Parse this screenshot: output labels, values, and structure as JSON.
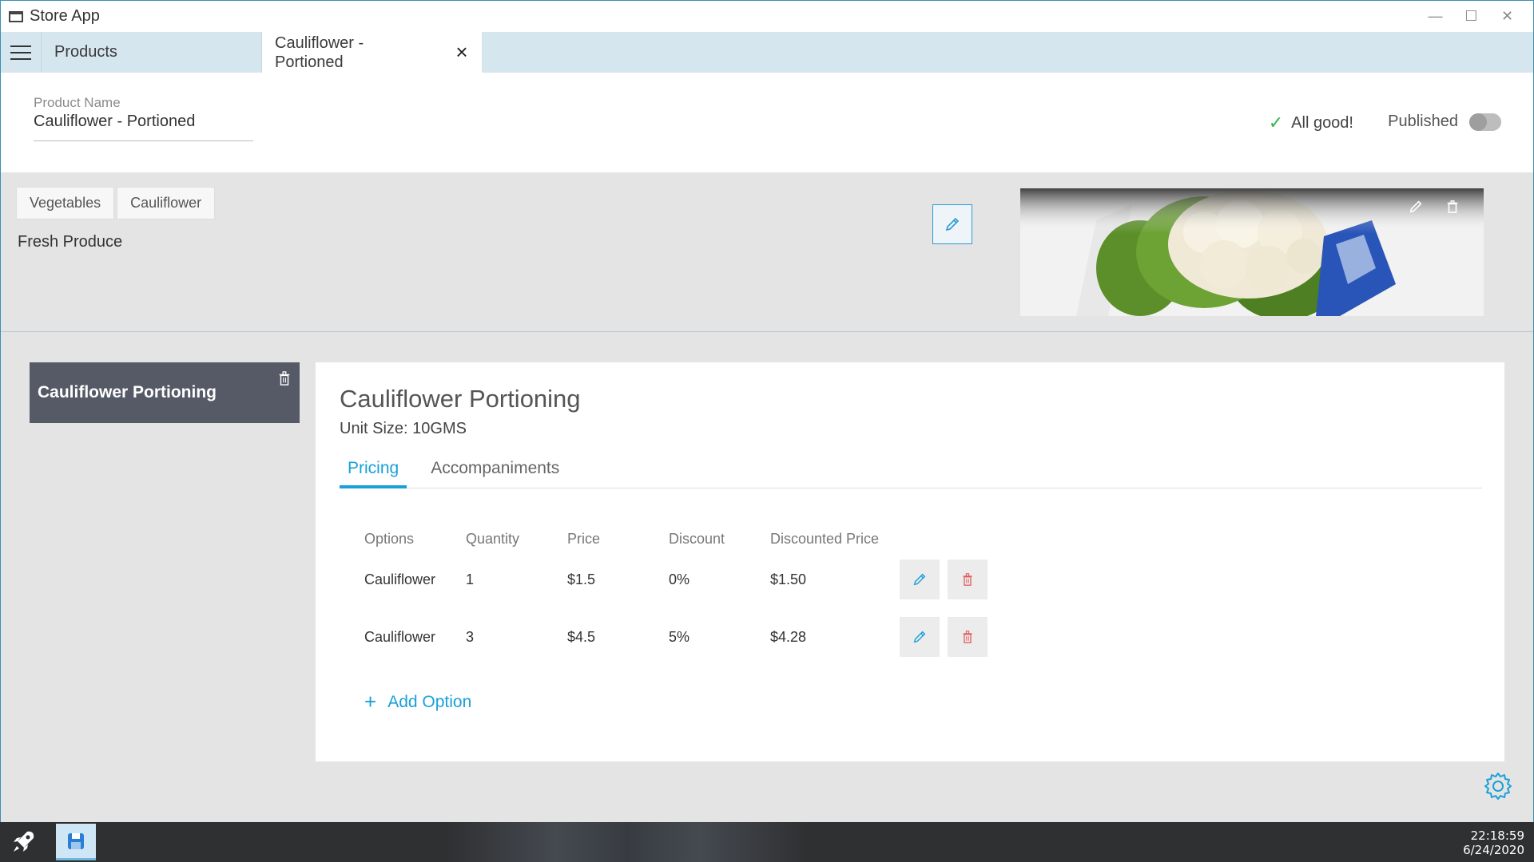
{
  "window": {
    "title": "Store App"
  },
  "tabs": {
    "products_label": "Products",
    "active_label": "Cauliflower - Portioned"
  },
  "header": {
    "product_name_label": "Product Name",
    "product_name_value": "Cauliflower - Portioned",
    "status_text": "All good!",
    "published_label": "Published",
    "published": false
  },
  "info": {
    "tags": [
      "Vegetables",
      "Cauliflower"
    ],
    "category": "Fresh Produce"
  },
  "sidebar": {
    "item_label": "Cauliflower Portioning"
  },
  "panel": {
    "title": "Cauliflower Portioning",
    "unit_size": "Unit Size: 10GMS",
    "tabs": [
      "Pricing",
      "Accompaniments"
    ],
    "active_tab": "Pricing",
    "table": {
      "headers": [
        "Options",
        "Quantity",
        "Price",
        "Discount",
        "Discounted Price"
      ],
      "rows": [
        [
          "Cauliflower",
          "1",
          "$1.5",
          "0%",
          "$1.50"
        ],
        [
          "Cauliflower",
          "3",
          "$4.5",
          "5%",
          "$4.28"
        ]
      ]
    },
    "add_option_label": "Add Option"
  },
  "taskbar": {
    "time": "22:18:59",
    "date": "6/24/2020"
  },
  "colors": {
    "accent": "#1aa0d8",
    "sidebar_card": "#555a66",
    "success": "#2fb84a",
    "danger": "#e05a5a"
  }
}
